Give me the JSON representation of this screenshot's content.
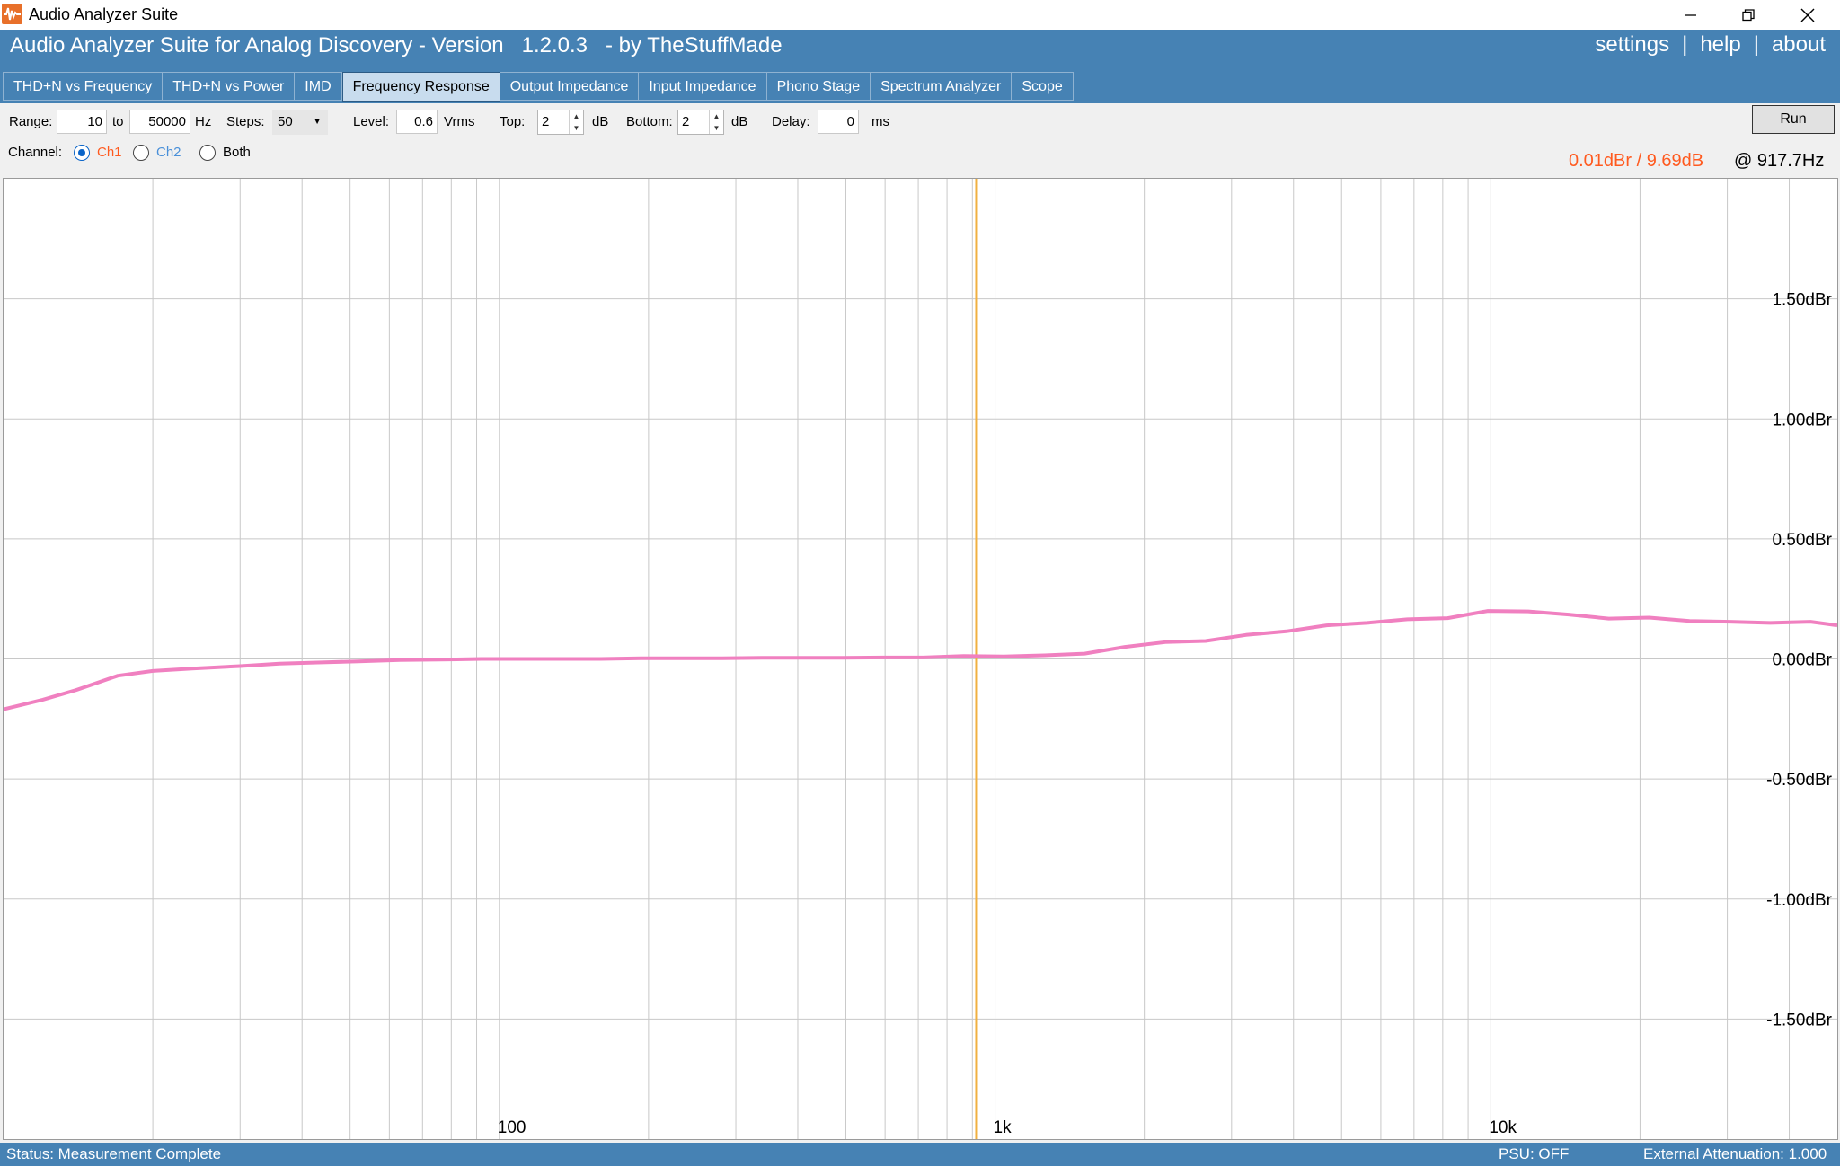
{
  "window": {
    "title": "Audio Analyzer Suite",
    "icons": [
      "minimize-icon",
      "restore-icon",
      "close-icon"
    ]
  },
  "header": {
    "title": "Audio Analyzer Suite for Analog Discovery - Version   1.2.0.3   - by TheStuffMade",
    "links": [
      "settings",
      "help",
      "about"
    ],
    "separator": "|"
  },
  "tabs": [
    {
      "label": "THD+N vs Frequency",
      "active": false
    },
    {
      "label": "THD+N vs Power",
      "active": false
    },
    {
      "label": "IMD",
      "active": false
    },
    {
      "label": "Frequency Response",
      "active": true
    },
    {
      "label": "Output Impedance",
      "active": false
    },
    {
      "label": "Input Impedance",
      "active": false
    },
    {
      "label": "Phono Stage",
      "active": false
    },
    {
      "label": "Spectrum Analyzer",
      "active": false
    },
    {
      "label": "Scope",
      "active": false
    }
  ],
  "controls": {
    "range_label": "Range:",
    "range_from": "10",
    "range_to_label": "to",
    "range_to": "50000",
    "range_unit": "Hz",
    "steps_label": "Steps:",
    "steps_value": "50",
    "level_label": "Level:",
    "level_value": "0.6",
    "level_unit": "Vrms",
    "top_label": "Top:",
    "top_value": "2",
    "top_unit": "dB",
    "bottom_label": "Bottom:",
    "bottom_value": "2",
    "bottom_unit": "dB",
    "delay_label": "Delay:",
    "delay_value": "0",
    "delay_unit": "ms",
    "run_label": "Run",
    "channel_label": "Channel:",
    "channels": [
      {
        "label": "Ch1",
        "checked": true,
        "color": "#ff5a1f"
      },
      {
        "label": "Ch2",
        "checked": false,
        "color": "#4a90d9"
      },
      {
        "label": "Both",
        "checked": false,
        "color": "#000000"
      }
    ]
  },
  "readout": {
    "value": "0.01dBr / 9.69dB",
    "freq": "@ 917.7Hz"
  },
  "chart_data": {
    "type": "line",
    "x_scale": "log",
    "xlim": [
      10,
      50000
    ],
    "ylim": [
      -2,
      2
    ],
    "grid": true,
    "x_tick_labels": [
      {
        "x": 100,
        "label": "100"
      },
      {
        "x": 1000,
        "label": "1k"
      },
      {
        "x": 10000,
        "label": "10k"
      }
    ],
    "y_tick_labels": [
      {
        "y": 1.5,
        "label": "1.50dBr"
      },
      {
        "y": 1.0,
        "label": "1.00dBr"
      },
      {
        "y": 0.5,
        "label": "0.50dBr"
      },
      {
        "y": 0.0,
        "label": "0.00dBr"
      },
      {
        "y": -0.5,
        "label": "-0.50dBr"
      },
      {
        "y": -1.0,
        "label": "-1.00dBr"
      },
      {
        "y": -1.5,
        "label": "-1.50dBr"
      }
    ],
    "cursor_x": 917.7,
    "cursor_color": "#f0b040",
    "series": [
      {
        "color": "#f080c0",
        "x": [
          10,
          12,
          14,
          17,
          20,
          24,
          30,
          36,
          43,
          52,
          63,
          76,
          92,
          110,
          133,
          160,
          193,
          233,
          281,
          339,
          409,
          493,
          594,
          717,
          864,
          1042,
          1257,
          1516,
          1828,
          2205,
          2659,
          3207,
          3868,
          4665,
          5626,
          6785,
          8183,
          9868,
          11900,
          14350,
          17300,
          20870,
          25170,
          30350,
          36610,
          44150,
          50000
        ],
        "y": [
          -0.21,
          -0.17,
          -0.13,
          -0.07,
          -0.05,
          -0.04,
          -0.03,
          -0.02,
          -0.015,
          -0.01,
          -0.005,
          -0.003,
          0.0,
          0.0,
          0.0,
          0.0,
          0.003,
          0.003,
          0.003,
          0.005,
          0.005,
          0.005,
          0.006,
          0.006,
          0.012,
          0.01,
          0.015,
          0.022,
          0.05,
          0.07,
          0.075,
          0.1,
          0.115,
          0.14,
          0.15,
          0.165,
          0.17,
          0.2,
          0.198,
          0.185,
          0.168,
          0.172,
          0.158,
          0.155,
          0.15,
          0.155,
          0.14
        ]
      }
    ]
  },
  "status": {
    "text": "Status: Measurement Complete",
    "psu": "PSU: OFF",
    "attenuation": "External Attenuation: 1.000"
  }
}
